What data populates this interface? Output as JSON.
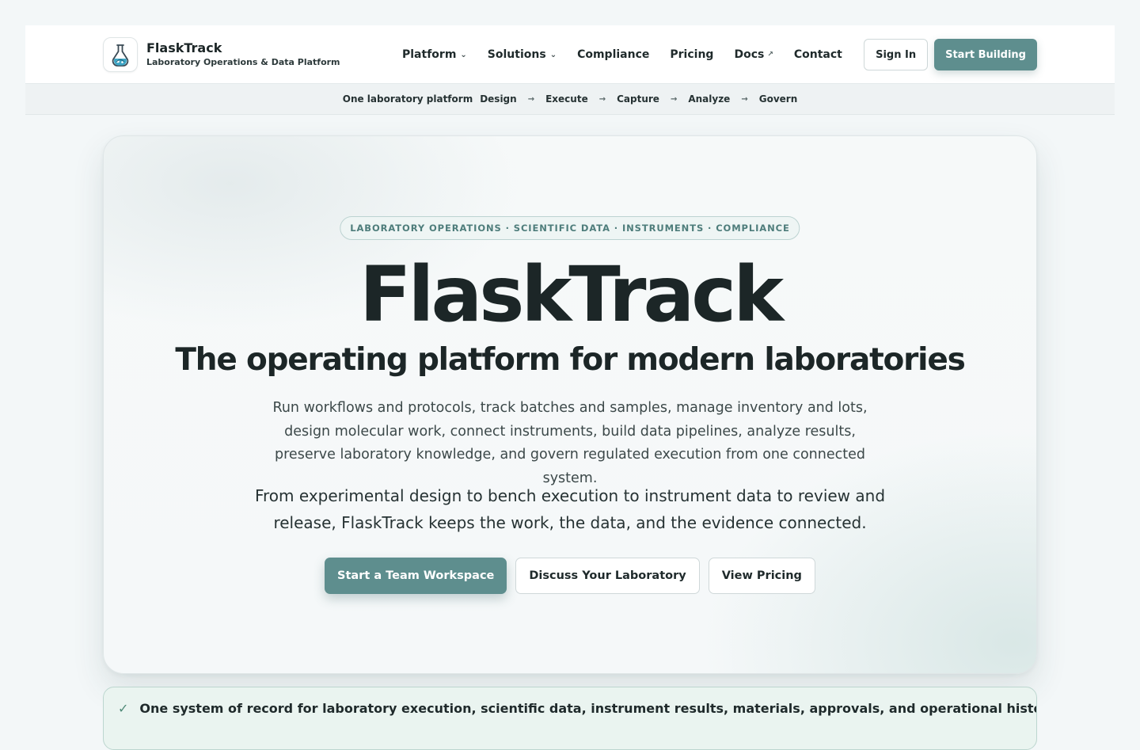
{
  "brand": {
    "name": "FlaskTrack",
    "tagline": "Laboratory Operations & Data Platform",
    "logo_icon": "flask-icon"
  },
  "nav": {
    "items": [
      {
        "label": "Platform",
        "has_dropdown": true
      },
      {
        "label": "Solutions",
        "has_dropdown": true
      },
      {
        "label": "Compliance"
      },
      {
        "label": "Pricing"
      },
      {
        "label": "Docs",
        "external": true
      },
      {
        "label": "Contact"
      }
    ],
    "caret": "⌄",
    "external_glyph": "↗"
  },
  "header_actions": {
    "sign_in": "Sign In",
    "start": "Start Building"
  },
  "flow": {
    "lead": "One laboratory platform",
    "steps": [
      "Design",
      "Execute",
      "Capture",
      "Analyze",
      "Govern"
    ],
    "arrow": "→"
  },
  "hero": {
    "pill": "LABORATORY OPERATIONS · SCIENTIFIC DATA · INSTRUMENTS · COMPLIANCE",
    "title": "FlaskTrack",
    "subtitle": "The operating platform for modern laboratories",
    "description": "Run workflows and protocols, track batches and samples, manage inventory and lots, design molecular work, connect instruments, build data pipelines, analyze results, preserve laboratory knowledge, and govern regulated execution from one connected system.",
    "lead": "From experimental design to bench execution to instrument data to review and release, FlaskTrack keeps the work, the data, and the evidence connected.",
    "cta_primary": "Start a Team Workspace",
    "cta_discuss": "Discuss Your Laboratory",
    "cta_pricing": "View Pricing"
  },
  "banner": {
    "check": "✓",
    "text": "One system of record for laboratory execution, scientific data, instrument results, materials, approvals, and operational history. Customer"
  },
  "colors": {
    "accent": "#5e8e8e",
    "page_bg": "#f3f7f8",
    "pill_text": "#4e7d7b",
    "banner_bg": "#eaf4f0"
  }
}
